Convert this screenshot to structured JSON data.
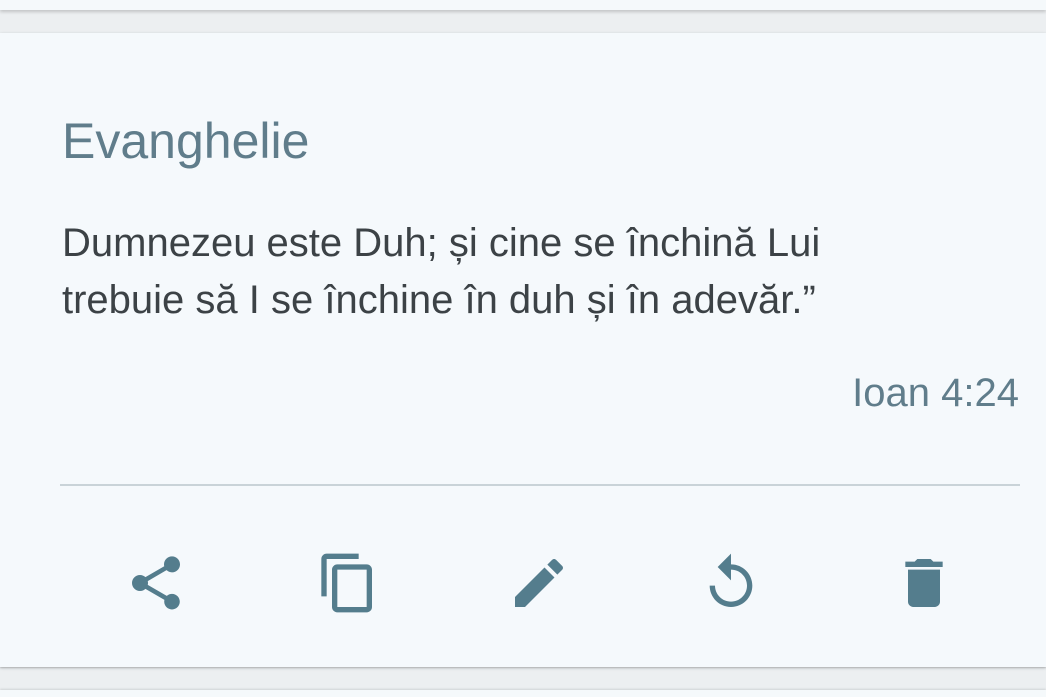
{
  "card": {
    "title": "Evanghelie",
    "verse_line1": "Dumnezeu este Duh; și cine se închină Lui",
    "verse_line2": "trebuie să I se închine în duh și în adevăr.”",
    "reference": "Ioan 4:24"
  },
  "actions": [
    {
      "name": "share",
      "icon": "share-icon"
    },
    {
      "name": "copy",
      "icon": "copy-icon"
    },
    {
      "name": "edit",
      "icon": "pencil-icon"
    },
    {
      "name": "reset",
      "icon": "restore-icon"
    },
    {
      "name": "delete",
      "icon": "trash-icon"
    }
  ],
  "colors": {
    "accent": "#607d8b",
    "icon": "#547d8d",
    "text": "#3c4246",
    "card_bg": "#f5f9fc",
    "divider": "#c9d3d8"
  }
}
